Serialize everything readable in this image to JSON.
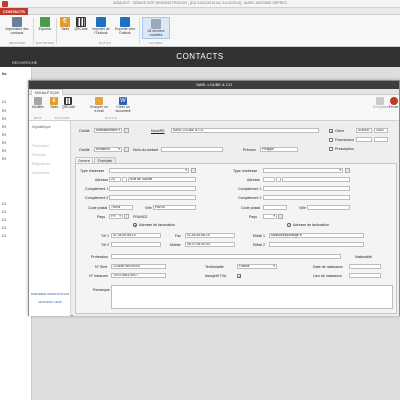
{
  "app": {
    "title": "AIDAUDIT - DEMOS SOP DEMONSTRATION - [DU 01/01/2014 AU 31/12/2014] - MARC ANTOINE SEPREZ",
    "active_tab": "CONTACTS"
  },
  "ribbon": {
    "buttons": [
      {
        "label": "Impression des contacts",
        "icon": "printer-icon"
      },
      {
        "label": "Exporter",
        "icon": "export-icon"
      },
      {
        "label": "Tarifs",
        "icon": "euro-icon"
      },
      {
        "label": "QRCode",
        "icon": "qrcode-icon"
      },
      {
        "label": "Importer de l'Outlook",
        "icon": "outlook-import-icon"
      },
      {
        "label": "Exporter vers Outlook",
        "icon": "outlook-export-icon"
      },
      {
        "label": "28 derniers modifiés",
        "icon": "recent-list-icon"
      }
    ],
    "groups": [
      "IMPRIMER",
      "EXPORTER",
      "OUTILS",
      "FILTRES"
    ]
  },
  "header": {
    "title": "CONTACTS"
  },
  "search": {
    "label": "RECHERCHE"
  },
  "left_list": {
    "first_label": "No",
    "rows": [
      "C1",
      "R1",
      "R1",
      "R1",
      "R1",
      "R1",
      "R1",
      "R1",
      "C1",
      "C1",
      "C1",
      "C1",
      "C1"
    ]
  },
  "dialog": {
    "title": "SARL LOUBE & CO",
    "tab": "SIGNALÉTIQUE",
    "toolbar": {
      "modifier": "Modifier",
      "tarifs": "Tarifs",
      "qrcode": "QRCode",
      "envoyer": "Envoyer un e-mail",
      "creer": "Créer un document",
      "groups": [
        "EDIT",
        "ACTIONS",
        "OUTILS"
      ],
      "enregistrer": "Enregistrer",
      "fin": "Fin de"
    },
    "side_nav": [
      "Signalétique",
      "Facturation",
      "Relances",
      "Règlements",
      "Documents"
    ],
    "last_modified": {
      "label": "DERNIÈRE MODIFICATION",
      "value": "25/10/2016 18:20"
    },
    "top": {
      "civilite_label": "Civilité",
      "civilite_value": "Etablissement",
      "nom_label": "Nom/RS",
      "nom_value": "SARL LOUBE & CO",
      "client_label": "Client",
      "client_code": "418000",
      "client_num": "1833",
      "fournisseur_label": "Fournisseur",
      "civilite2_value": "Monsieur",
      "contact_label": "Nom du contact",
      "prenom_label": "Prénom",
      "prenom_value": "Philippe",
      "prescription_label": "Prescription"
    },
    "subtabs": [
      "Général",
      "Formules"
    ],
    "form": {
      "type_adresse": "Type d'adresse",
      "adresse": "Adresse",
      "adresse_num": "23",
      "adresse_value": "Rue de Savoie",
      "complement1": "Complément 1",
      "complement2": "Complément 2",
      "code_postal": "Code postal",
      "code_postal_value": "75004",
      "ville": "Ville",
      "ville_value": "PARIS",
      "pays": "Pays",
      "pays_code": "FR",
      "pays_value": "FRANCE",
      "facturation": "Adresse de facturation",
      "tel1": "Tél 1",
      "tel1_value": "01.44.55.56.14",
      "fax": "Fax",
      "fax_value": "01.44.55.56.15",
      "email1": "EMail 1",
      "email1_value": "sarlloube@orange.fr",
      "tel2": "Tél 2",
      "mobile": "Mobile",
      "mobile_value": "06.07.08.09.XX",
      "email2": "EMail 2",
      "profession": "Profession",
      "nationalite": "Nationalité",
      "siret": "N° Siret",
      "siret_value": "123456789100XX",
      "territorialite": "Territorialité",
      "territorialite_value": "France",
      "date_naissance": "Date de naissance",
      "intracom": "N° Intracom",
      "intracom_value": "TEST456376477",
      "assujetti": "Assujetti TVA",
      "lieu_naissance": "Lieu de naissance",
      "remarque": "Remarque"
    }
  }
}
